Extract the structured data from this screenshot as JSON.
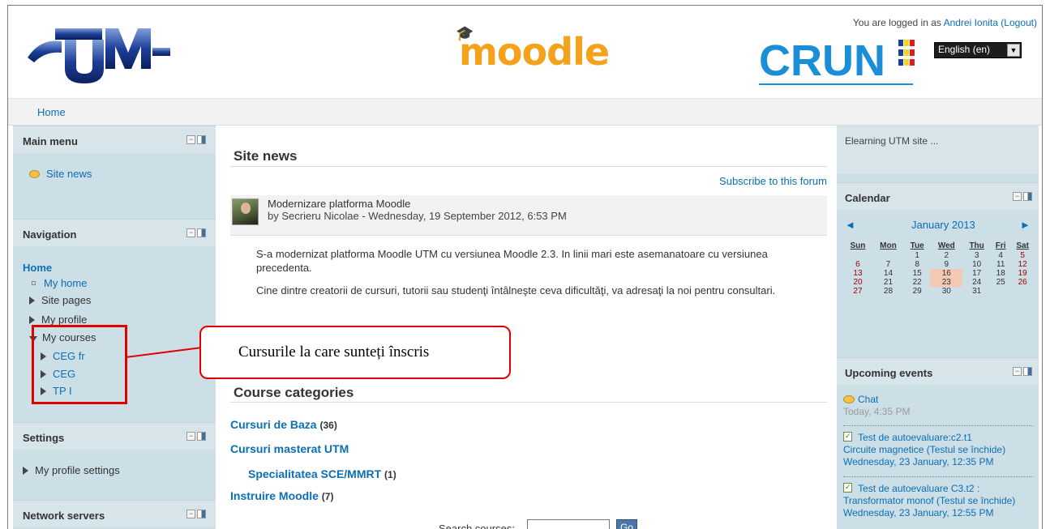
{
  "header": {
    "logo_left_text": "UTM",
    "logo_center_text": "moodle",
    "logo_right_text": "CRUN",
    "login_prefix": "You are logged in as ",
    "user_name": "Andrei Ionita",
    "logout_label": "(Logout)",
    "language": "English (en)"
  },
  "breadcrumb": {
    "home": "Home"
  },
  "left": {
    "main_menu": {
      "title": "Main menu",
      "items": [
        "Site news"
      ]
    },
    "navigation": {
      "title": "Navigation",
      "home": "Home",
      "my_home": "My home",
      "site_pages": "Site pages",
      "my_profile": "My profile",
      "my_courses": "My courses",
      "courses": [
        "CEG fr",
        "CEG",
        "TP I"
      ]
    },
    "settings": {
      "title": "Settings",
      "my_profile_settings": "My profile settings"
    },
    "network_servers": {
      "title": "Network servers"
    }
  },
  "center": {
    "site_news_title": "Site news",
    "subscribe_label": "Subscribe to this forum",
    "post": {
      "subject": "Modernizare platforma Moodle",
      "byline": "by Secrieru Nicolae - Wednesday, 19 September 2012, 6:53 PM",
      "paragraph1": "S-a modernizat platforma Moodle UTM cu versiunea Moodle 2.3. In linii mari este asemanatoare cu versiunea precedenta.",
      "paragraph2": "Cine dintre creatorii de cursuri, tutorii sau studenţi întâlneşte ceva dificultăţi, va adresaţi la noi pentru consultari."
    },
    "course_categories_title": "Course categories",
    "categories": [
      {
        "name": "Cursuri de Baza",
        "count": "(36)"
      },
      {
        "name": "Cursuri masterat UTM",
        "count": ""
      },
      {
        "name": "Specialitatea SCE/MMRT",
        "count": "(1)"
      },
      {
        "name": "Instruire Moodle",
        "count": "(7)"
      }
    ],
    "search_label": "Search courses:",
    "search_value": "",
    "go_label": "Go"
  },
  "right": {
    "site_desc": "Elearning UTM site ...",
    "calendar": {
      "title": "Calendar",
      "prev": "◄",
      "month": "January 2013",
      "next": "►",
      "days": [
        "Sun",
        "Mon",
        "Tue",
        "Wed",
        "Thu",
        "Fri",
        "Sat"
      ],
      "weeks": [
        [
          "",
          "",
          "1",
          "2",
          "3",
          "4",
          "5"
        ],
        [
          "6",
          "7",
          "8",
          "9",
          "10",
          "11",
          "12"
        ],
        [
          "13",
          "14",
          "15",
          "16",
          "17",
          "18",
          "19"
        ],
        [
          "20",
          "21",
          "22",
          "23",
          "24",
          "25",
          "26"
        ],
        [
          "27",
          "28",
          "29",
          "30",
          "31",
          "",
          ""
        ]
      ],
      "highlighted": [
        "16",
        "23"
      ]
    },
    "upcoming": {
      "title": "Upcoming events",
      "events": [
        {
          "icon": "chat-icon",
          "name": "Chat",
          "sub": "",
          "time": "Today, 4:35 PM"
        },
        {
          "icon": "quiz-icon",
          "name": "Test de autoevaluare:c2.t1",
          "sub": "Circuite magnetice (Testul se închide)",
          "time": "Wednesday, 23 January, 12:35 PM"
        },
        {
          "icon": "quiz-icon",
          "name": "Test de autoevaluare C3.t2 :",
          "sub": "Transformator monof (Testul se închide)",
          "time": "Wednesday, 23 January, 12:55 PM"
        }
      ]
    }
  },
  "annotation": {
    "text": "Cursurile la care sunteți înscris"
  },
  "colors": {
    "link": "#0a6fb5",
    "sidebar_bg": "#ccdee6",
    "annotation_red": "#e00000",
    "weekend_red": "#a30000"
  }
}
